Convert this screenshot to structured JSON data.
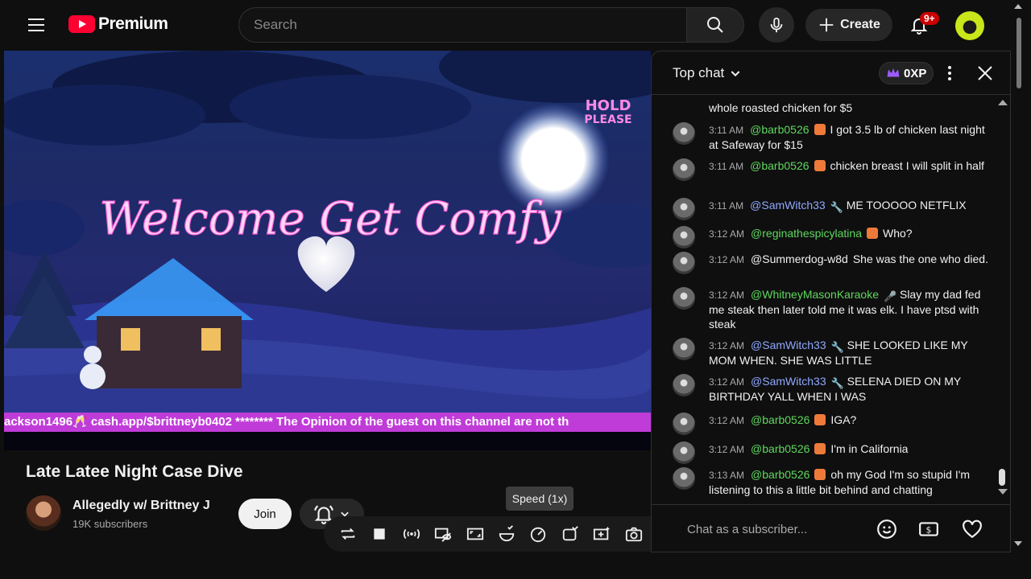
{
  "header": {
    "logo_text": "Premium",
    "search_placeholder": "Search",
    "create_label": "Create",
    "notification_count": "9+"
  },
  "player": {
    "overlay_hold": "HOLD",
    "overlay_please": "PLEASE",
    "overlay_welcome": "Welcome Get Comfy",
    "ticker_text": "ackson1496🥂 cash.app/$brittneyb0402 ******** The Opinion of the guest on this channel are not th",
    "speed_tooltip": "Speed (1x)"
  },
  "video": {
    "title": "Late Latee Night Case Dive",
    "channel_name": "Allegedly w/ Brittney J",
    "subscribers": "19K subscribers",
    "join_label": "Join"
  },
  "chat": {
    "mode_label": "Top chat",
    "xp_label": "0XP",
    "input_placeholder": "Chat as a subscriber...",
    "messages": [
      {
        "time": "",
        "author": "",
        "text": "whole roasted chicken for $5",
        "author_style": "plain",
        "badge": ""
      },
      {
        "time": "3:11 AM",
        "author": "@barb0526",
        "text": "I got 3.5 lb of chicken last night at Safeway for $15",
        "author_style": "green",
        "badge": "member"
      },
      {
        "time": "3:11 AM",
        "author": "@barb0526",
        "text": "chicken breast I will split in half",
        "author_style": "green",
        "badge": "member"
      },
      {
        "time": "3:11 AM",
        "author": "@SamWitch33",
        "text": "ME TOOOOO NETFLIX",
        "author_style": "blue",
        "badge": "wrench"
      },
      {
        "time": "3:12 AM",
        "author": "@reginathespicylatina",
        "text": "Who?",
        "author_style": "green",
        "badge": "member"
      },
      {
        "time": "3:12 AM",
        "author": "@Summerdog-w8d",
        "text": "She was the one who died.",
        "author_style": "plain",
        "badge": ""
      },
      {
        "time": "3:12 AM",
        "author": "@WhitneyMasonKaraoke",
        "text": "Slay my dad fed me steak then later told me it was elk. I have ptsd with steak",
        "author_style": "green",
        "badge": "mic"
      },
      {
        "time": "3:12 AM",
        "author": "@SamWitch33",
        "text": "SHE LOOKED LIKE MY MOM WHEN. SHE WAS LITTLE",
        "author_style": "blue",
        "badge": "wrench"
      },
      {
        "time": "3:12 AM",
        "author": "@SamWitch33",
        "text": "SELENA DIED ON MY BIRTHDAY YALL WHEN I WAS",
        "author_style": "blue",
        "badge": "wrench"
      },
      {
        "time": "3:12 AM",
        "author": "@barb0526",
        "text": "IGA?",
        "author_style": "green",
        "badge": "member"
      },
      {
        "time": "3:12 AM",
        "author": "@barb0526",
        "text": "I'm in California",
        "author_style": "green",
        "badge": "member"
      },
      {
        "time": "3:13 AM",
        "author": "@barb0526",
        "text": "oh my God I'm so stupid I'm listening to this a little bit behind and chatting",
        "author_style": "green",
        "badge": "member"
      }
    ]
  },
  "colors": {
    "brand_red": "#ff0033",
    "ticker_bg": "#c03cd8",
    "neon_pink": "#ff8ae6",
    "member_green": "#5ed85e",
    "mod_blue": "#8fa8ff"
  }
}
